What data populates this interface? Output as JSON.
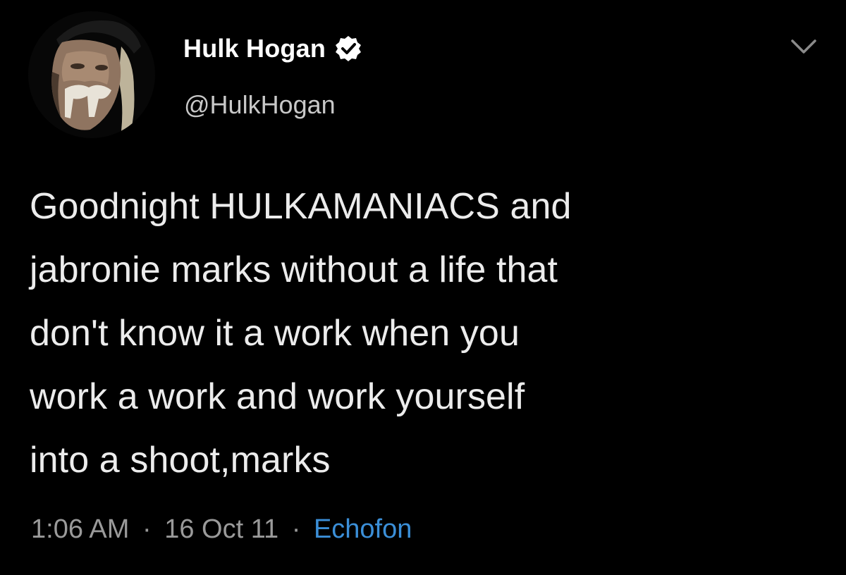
{
  "tweet": {
    "author": {
      "display_name": "Hulk Hogan",
      "handle": "@HulkHogan",
      "verified": true
    },
    "text": "Goodnight HULKAMANIACS and\njabronie marks without a life that\ndon't know it a work when you\nwork a work and work yourself\ninto a shoot,marks",
    "time": "1:06 AM",
    "date": "16 Oct 11",
    "separator": "·",
    "source": "Echofon"
  },
  "icons": {
    "verified": "verified-badge-icon",
    "more": "chevron-down-icon"
  },
  "colors": {
    "background": "#000000",
    "text": "#ececec",
    "meta": "#9a9a9a",
    "link": "#3b8fd8"
  }
}
